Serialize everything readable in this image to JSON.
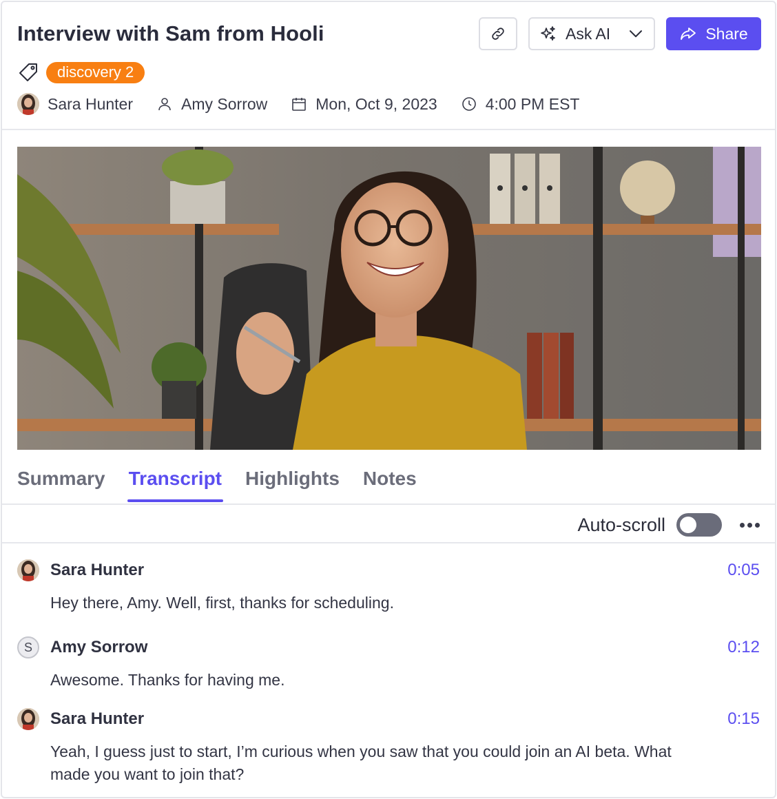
{
  "header": {
    "title": "Interview with Sam from Hooli",
    "ask_ai_label": "Ask AI",
    "share_label": "Share",
    "tag": "discovery 2"
  },
  "meta": {
    "interviewer": "Sara Hunter",
    "participant": "Amy Sorrow",
    "date": "Mon, Oct 9, 2023",
    "time": "4:00 PM EST"
  },
  "tabs": [
    {
      "label": "Summary",
      "active": false
    },
    {
      "label": "Transcript",
      "active": true
    },
    {
      "label": "Highlights",
      "active": false
    },
    {
      "label": "Notes",
      "active": false
    }
  ],
  "transcript_controls": {
    "autoscroll_label": "Auto-scroll",
    "autoscroll_on": false
  },
  "transcript": [
    {
      "speaker": "Sara Hunter",
      "avatar": "photo",
      "time": "0:05",
      "text": "Hey there, Amy. Well, first, thanks for scheduling."
    },
    {
      "speaker": "Amy Sorrow",
      "avatar": "S",
      "time": "0:12",
      "text": "Awesome. Thanks for having me."
    },
    {
      "speaker": "Sara Hunter",
      "avatar": "photo",
      "time": "0:15",
      "text": "Yeah, I guess just to start, I’m curious when you saw that you could join an AI beta. What made you want to join that?"
    }
  ],
  "colors": {
    "accent": "#5b4ef0",
    "tag": "#f87f12",
    "toggle_off": "#6a6c7a"
  }
}
